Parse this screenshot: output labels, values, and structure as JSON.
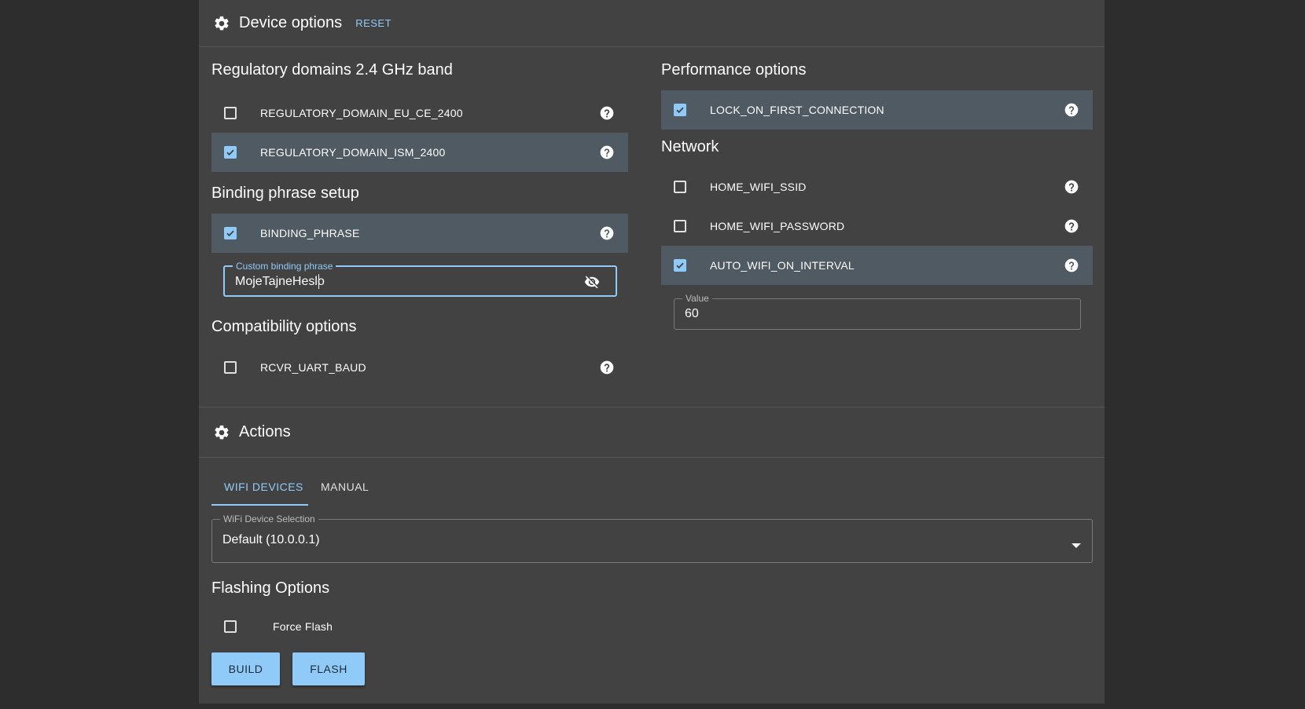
{
  "device_options": {
    "title": "Device options",
    "reset_label": "RESET"
  },
  "regulatory": {
    "heading": "Regulatory domains 2.4 GHz band",
    "options": [
      {
        "label": "REGULATORY_DOMAIN_EU_CE_2400",
        "checked": false
      },
      {
        "label": "REGULATORY_DOMAIN_ISM_2400",
        "checked": true
      }
    ]
  },
  "binding": {
    "heading": "Binding phrase setup",
    "option": {
      "label": "BINDING_PHRASE",
      "checked": true
    },
    "field_label": "Custom binding phrase",
    "field_value": "MojeTajneHeslo"
  },
  "compatibility": {
    "heading": "Compatibility options",
    "option": {
      "label": "RCVR_UART_BAUD",
      "checked": false
    }
  },
  "performance": {
    "heading": "Performance options",
    "option": {
      "label": "LOCK_ON_FIRST_CONNECTION",
      "checked": true
    }
  },
  "network": {
    "heading": "Network",
    "options": [
      {
        "label": "HOME_WIFI_SSID",
        "checked": false
      },
      {
        "label": "HOME_WIFI_PASSWORD",
        "checked": false
      },
      {
        "label": "AUTO_WIFI_ON_INTERVAL",
        "checked": true
      }
    ],
    "value_label": "Value",
    "value": "60"
  },
  "actions": {
    "title": "Actions",
    "tabs": [
      {
        "label": "WIFI DEVICES",
        "active": true
      },
      {
        "label": "MANUAL",
        "active": false
      }
    ],
    "wifi_select_label": "WiFi Device Selection",
    "wifi_select_value": "Default (10.0.0.1)",
    "flashing_heading": "Flashing Options",
    "force_flash": {
      "label": "Force Flash",
      "checked": false
    },
    "build_label": "BUILD",
    "flash_label": "FLASH"
  },
  "colors": {
    "accent": "#90caf9",
    "panel": "#424242",
    "background": "#2d2d2d",
    "checked_row": "#4f5a63"
  },
  "icons": [
    "gear-icon",
    "help-icon",
    "visibility-off-icon",
    "dropdown-arrow-icon",
    "checkbox-icon"
  ]
}
